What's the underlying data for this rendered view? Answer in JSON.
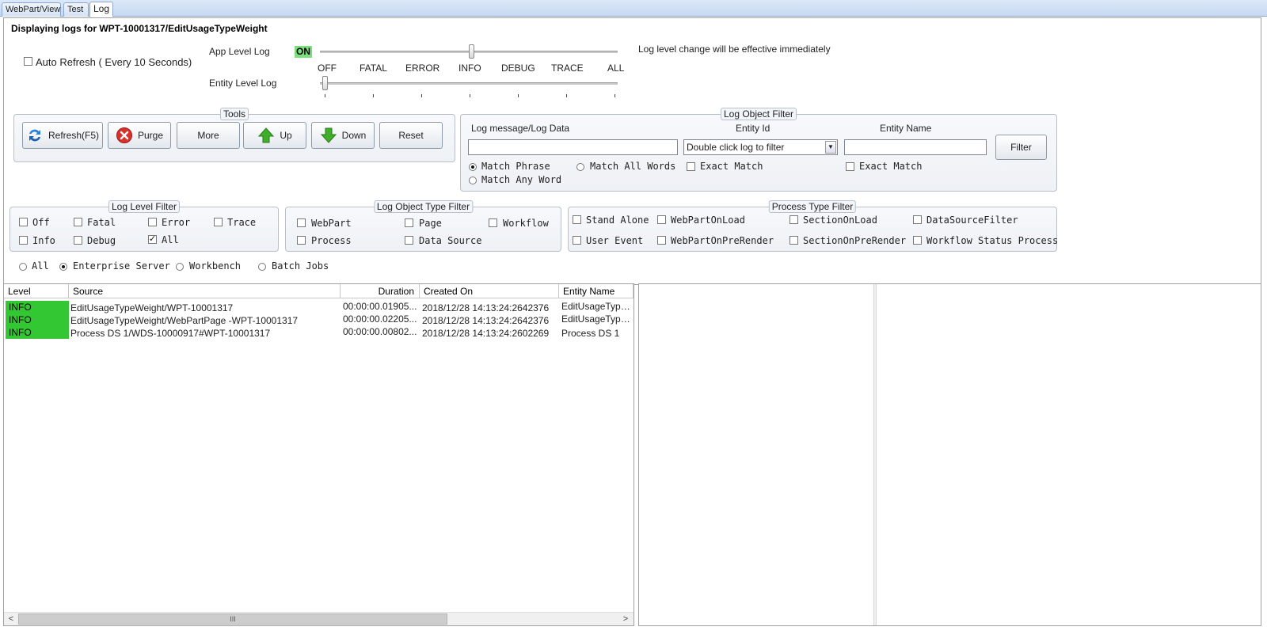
{
  "tabs": [
    {
      "label": "WebPart/View"
    },
    {
      "label": "Test"
    },
    {
      "label": "Log"
    }
  ],
  "header": {
    "title": "Displaying logs for WPT-10001317/EditUsageTypeWeight"
  },
  "auto_refresh": {
    "label": "Auto Refresh ( Every 10 Seconds)",
    "checked": false
  },
  "log_levels": {
    "app_label": "App Level Log",
    "on_badge": "ON",
    "entity_label": "Entity Level Log",
    "notice": "Log level change will be effective immediately",
    "levels": [
      "OFF",
      "FATAL",
      "ERROR",
      "INFO",
      "DEBUG",
      "TRACE",
      "ALL"
    ],
    "app_level": "INFO",
    "entity_level": "OFF"
  },
  "tools": {
    "title": "Tools",
    "buttons": {
      "refresh": "Refresh(F5)",
      "purge": "Purge",
      "more": "More",
      "up": "Up",
      "down": "Down",
      "reset": "Reset"
    }
  },
  "log_object_filter": {
    "title": "Log Object Filter",
    "message_label": "Log message/Log Data",
    "entity_id_label": "Entity Id",
    "entity_id_value": "Double click log to filter",
    "entity_name_label": "Entity Name",
    "filter_button": "Filter",
    "match_phrase": "Match Phrase",
    "match_all_words": "Match All Words",
    "match_any_word": "Match Any Word",
    "exact_match_1": "Exact Match",
    "exact_match_2": "Exact Match",
    "selected_match": "Match Phrase"
  },
  "log_level_filter": {
    "title": "Log Level Filter",
    "off": "Off",
    "fatal": "Fatal",
    "error": "Error",
    "trace": "Trace",
    "info": "Info",
    "debug": "Debug",
    "all": "All",
    "checked": [
      "All"
    ]
  },
  "log_object_type_filter": {
    "title": "Log Object Type Filter",
    "webpart": "WebPart",
    "page": "Page",
    "workflow": "Workflow",
    "process": "Process",
    "data_source": "Data Source"
  },
  "process_type_filter": {
    "title": "Process Type Filter",
    "stand_alone": "Stand Alone",
    "webpart_onload": "WebPartOnLoad",
    "section_onload": "SectionOnLoad",
    "datasource_filter": "DataSourceFilter",
    "user_event": "User Event",
    "webpart_onprerender": "WebPartOnPreRender",
    "section_onprerender": "SectionOnPreRender",
    "workflow_status_process": "Workflow Status Process"
  },
  "server_scope": {
    "all": "All",
    "enterprise": "Enterprise Server",
    "workbench": "Workbench",
    "batch": "Batch Jobs",
    "selected": "Enterprise Server"
  },
  "grid": {
    "columns": {
      "level": "Level",
      "source": "Source",
      "duration": "Duration",
      "created": "Created On",
      "entity": "Entity Name"
    },
    "rows": [
      {
        "level": "INFO",
        "source": "EditUsageTypeWeight/WPT-10001317",
        "duration": "00:00:00.01905...",
        "created": "2018/12/28 14:13:24:2642376",
        "entity": "EditUsageTypeWei..."
      },
      {
        "level": "INFO",
        "source": "EditUsageTypeWeight/WebPartPage -WPT-10001317",
        "duration": "00:00:00.02205...",
        "created": "2018/12/28 14:13:24:2642376",
        "entity": "EditUsageTypeWei..."
      },
      {
        "level": "INFO",
        "source": "Process DS 1/WDS-10000917#WPT-10001317",
        "duration": "00:00:00.00802...",
        "created": "2018/12/28 14:13:24:2602269",
        "entity": "Process DS 1"
      }
    ],
    "level_color": "#33c733",
    "scroll_grip": "III"
  }
}
